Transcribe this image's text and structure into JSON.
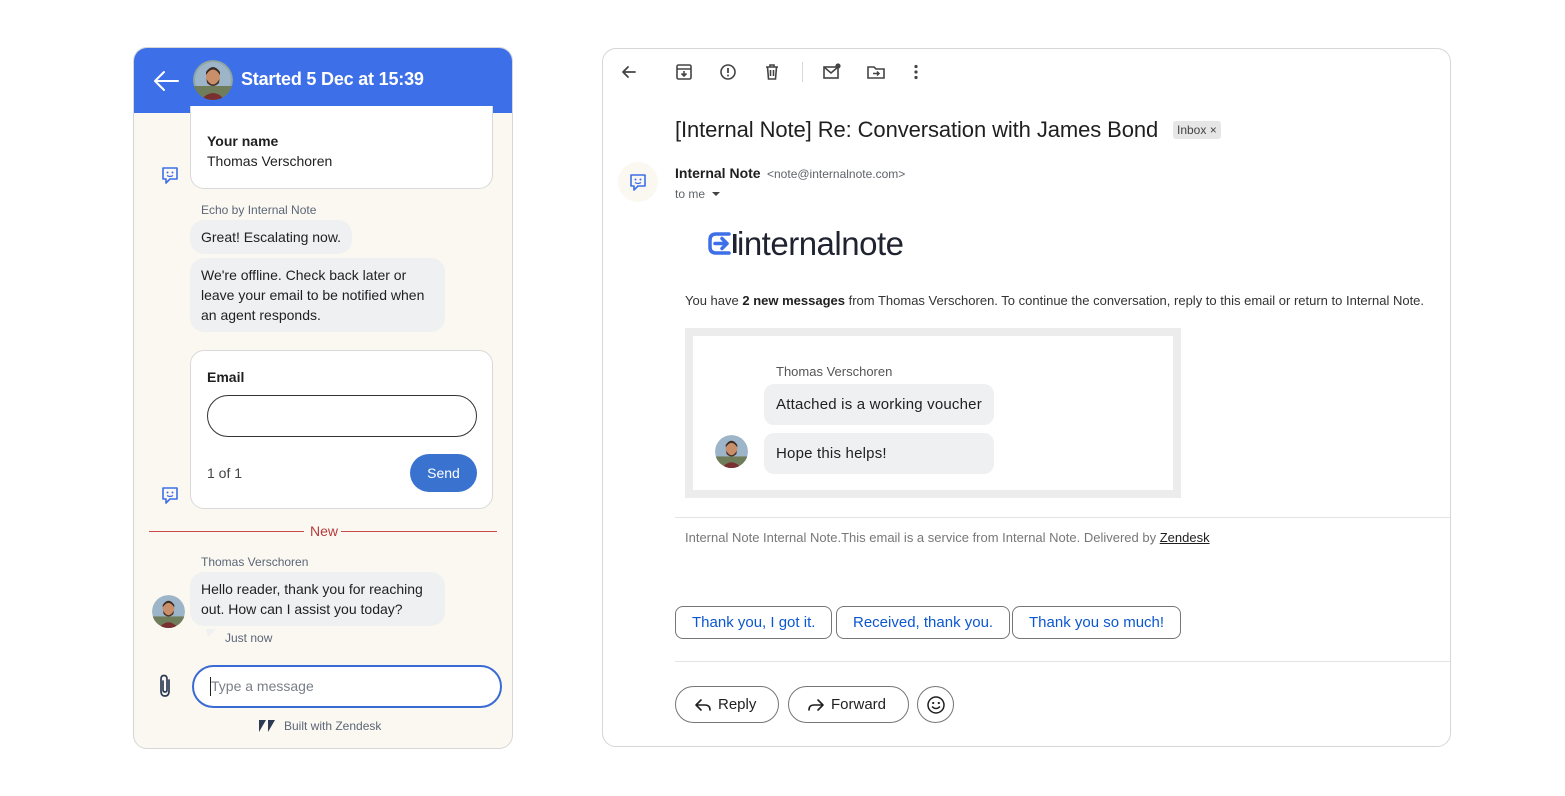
{
  "chat": {
    "header_title": "Started 5 Dec at 15:39",
    "name_card": {
      "label": "Your name",
      "value": "Thomas Verschoren"
    },
    "bot_sender": "Echo by Internal Note",
    "bot_messages": [
      "Great! Escalating now.",
      "We're offline. Check back later or leave your email to be notified when an agent responds."
    ],
    "email_card": {
      "label": "Email",
      "pager": "1 of 1",
      "send_label": "Send"
    },
    "new_divider": "New",
    "user_sender": "Thomas Verschoren",
    "user_message": "Hello reader, thank you for reaching out. How can I assist you today?",
    "user_timestamp": "Just now",
    "composer_placeholder": "Type a message",
    "footer": "Built with Zendesk",
    "accent_color": "#3d6fe8"
  },
  "email": {
    "subject": "[Internal Note] Re: Conversation with James Bond",
    "label_chip": "Inbox ×",
    "from_name": "Internal Note",
    "from_email": "<note@internalnote.com>",
    "to": "to me",
    "logo_text": "internalnote",
    "intro_prefix": "You have ",
    "intro_bold": "2 new messages",
    "intro_suffix": " from Thomas Verschoren. To continue the conversation, reply to this email or return to Internal Note.",
    "quote": {
      "sender": "Thomas Verschoren",
      "messages": [
        "Attached is a working voucher",
        "Hope this helps!"
      ]
    },
    "footer_text": "Internal Note Internal Note.This email is a service from Internal Note. Delivered by ",
    "footer_link": "Zendesk",
    "smart_replies": [
      "Thank you, I got it.",
      "Received, thank you.",
      "Thank you so much!"
    ],
    "reply_label": "Reply",
    "forward_label": "Forward",
    "toolbar_icons": [
      "back-arrow-icon",
      "archive-icon",
      "report-spam-icon",
      "delete-icon",
      "mark-unread-icon",
      "move-to-icon",
      "more-vert-icon"
    ],
    "link_color": "#0b57d0"
  }
}
